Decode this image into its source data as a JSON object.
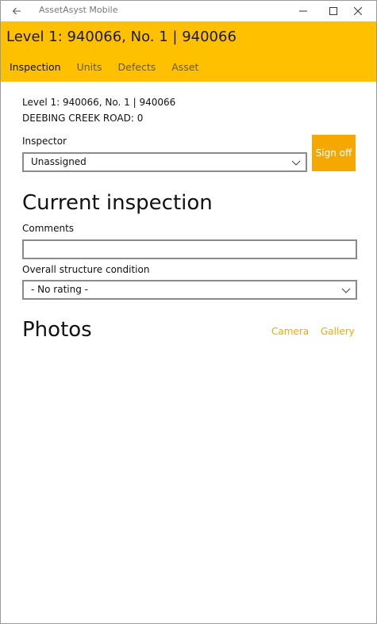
{
  "window": {
    "app_title": "AssetAsyst Mobile"
  },
  "header": {
    "title": "Level 1: 940066, No. 1 | 940066",
    "tabs": [
      {
        "label": "Inspection",
        "active": true
      },
      {
        "label": "Units",
        "active": false
      },
      {
        "label": "Defects",
        "active": false
      },
      {
        "label": "Asset",
        "active": false
      }
    ]
  },
  "details": {
    "line1": "Level 1: 940066, No. 1 | 940066",
    "line2": "DEEBING CREEK ROAD: 0"
  },
  "inspector": {
    "label": "Inspector",
    "value": "Unassigned",
    "signoff_label": "Sign off"
  },
  "current_inspection": {
    "title": "Current inspection",
    "comments_label": "Comments",
    "comments_value": "",
    "condition_label": "Overall structure condition",
    "condition_value": "- No rating -"
  },
  "photos": {
    "title": "Photos",
    "camera_label": "Camera",
    "gallery_label": "Gallery"
  },
  "colors": {
    "header_bg": "#ffc000",
    "accent": "#f5a900"
  },
  "icons": {
    "back": "back-arrow-icon",
    "minimize": "minimize-icon",
    "maximize": "maximize-icon",
    "close": "close-icon",
    "dropdown": "chevron-down-icon"
  }
}
